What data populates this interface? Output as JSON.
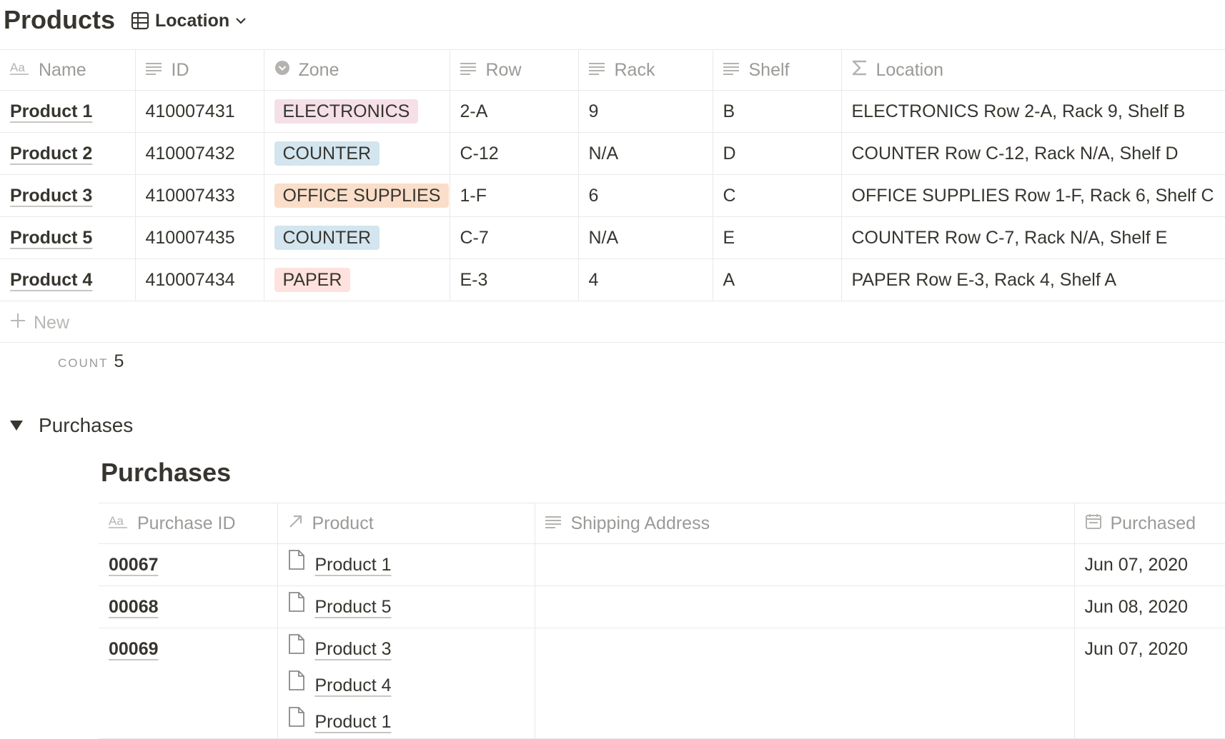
{
  "header": {
    "title": "Products",
    "view_label": "Location"
  },
  "products": {
    "columns": [
      "Name",
      "ID",
      "Zone",
      "Row",
      "Rack",
      "Shelf",
      "Location"
    ],
    "rows": [
      {
        "name": "Product 1",
        "id": "410007431",
        "zone": "ELECTRONICS",
        "zone_color": "#f5e0e9",
        "row": "2-A",
        "rack": "9",
        "shelf": "B",
        "location": "ELECTRONICS Row 2-A, Rack 9, Shelf B"
      },
      {
        "name": "Product 2",
        "id": "410007432",
        "zone": "COUNTER",
        "zone_color": "#d3e5ef",
        "row": "C-12",
        "rack": "N/A",
        "shelf": "D",
        "location": "COUNTER Row C-12, Rack N/A, Shelf D"
      },
      {
        "name": "Product 3",
        "id": "410007433",
        "zone": "OFFICE SUPPLIES",
        "zone_color": "#fadec9",
        "row": "1-F",
        "rack": "6",
        "shelf": "C",
        "location": "OFFICE SUPPLIES Row 1-F, Rack 6, Shelf C"
      },
      {
        "name": "Product 5",
        "id": "410007435",
        "zone": "COUNTER",
        "zone_color": "#d3e5ef",
        "row": "C-7",
        "rack": "N/A",
        "shelf": "E",
        "location": "COUNTER Row C-7, Rack N/A, Shelf E"
      },
      {
        "name": "Product 4",
        "id": "410007434",
        "zone": "PAPER",
        "zone_color": "#ffe2dd",
        "row": "E-3",
        "rack": "4",
        "shelf": "A",
        "location": "PAPER Row E-3, Rack 4, Shelf A"
      }
    ],
    "new_label": "New",
    "count_label": "COUNT",
    "count_value": "5"
  },
  "toggle": {
    "label": "Purchases"
  },
  "purchases": {
    "title": "Purchases",
    "columns": [
      "Purchase ID",
      "Product",
      "Shipping Address",
      "Purchased"
    ],
    "rows": [
      {
        "pid": "00067",
        "products": [
          "Product 1"
        ],
        "shipping": "",
        "purchased": "Jun 07, 2020"
      },
      {
        "pid": "00068",
        "products": [
          "Product 5"
        ],
        "shipping": "",
        "purchased": "Jun 08, 2020"
      },
      {
        "pid": "00069",
        "products": [
          "Product 3",
          "Product 4",
          "Product 1"
        ],
        "shipping": "",
        "purchased": "Jun 07, 2020"
      }
    ]
  },
  "icons": {
    "view": "table-icon",
    "dropdown": "chevron-down-icon",
    "title_prop": "text-aa-icon",
    "text_prop": "text-lines-icon",
    "select_prop": "select-icon",
    "formula_prop": "sigma-icon",
    "relation_prop": "relation-arrow-icon",
    "date_prop": "calendar-icon",
    "page": "page-icon",
    "add": "plus-icon"
  }
}
